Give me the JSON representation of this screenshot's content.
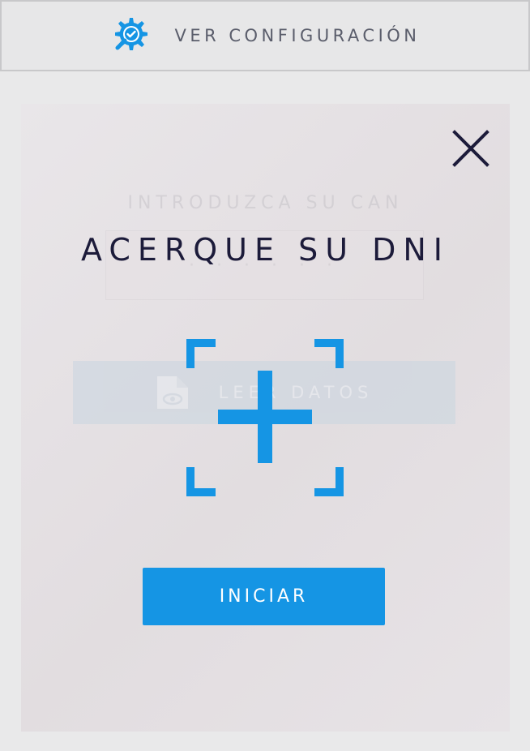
{
  "topbar": {
    "title": "VER CONFIGURACIÓN",
    "icon": "gear-check-search-icon"
  },
  "background_form": {
    "prompt": "INTRODUZCA SU CAN",
    "input_value": "· · · · · ·",
    "read_button_label": "LEER DATOS",
    "read_button_icon": "document-eye-icon"
  },
  "overlay": {
    "heading": "ACERQUE SU DNI",
    "scan_icon": "scan-frame-plus-icon",
    "close_icon": "close-icon",
    "start_button_label": "INICIAR"
  },
  "colors": {
    "accent": "#1595e4",
    "heading": "#1c1b3a",
    "topbar_text": "#5a5d6b"
  }
}
